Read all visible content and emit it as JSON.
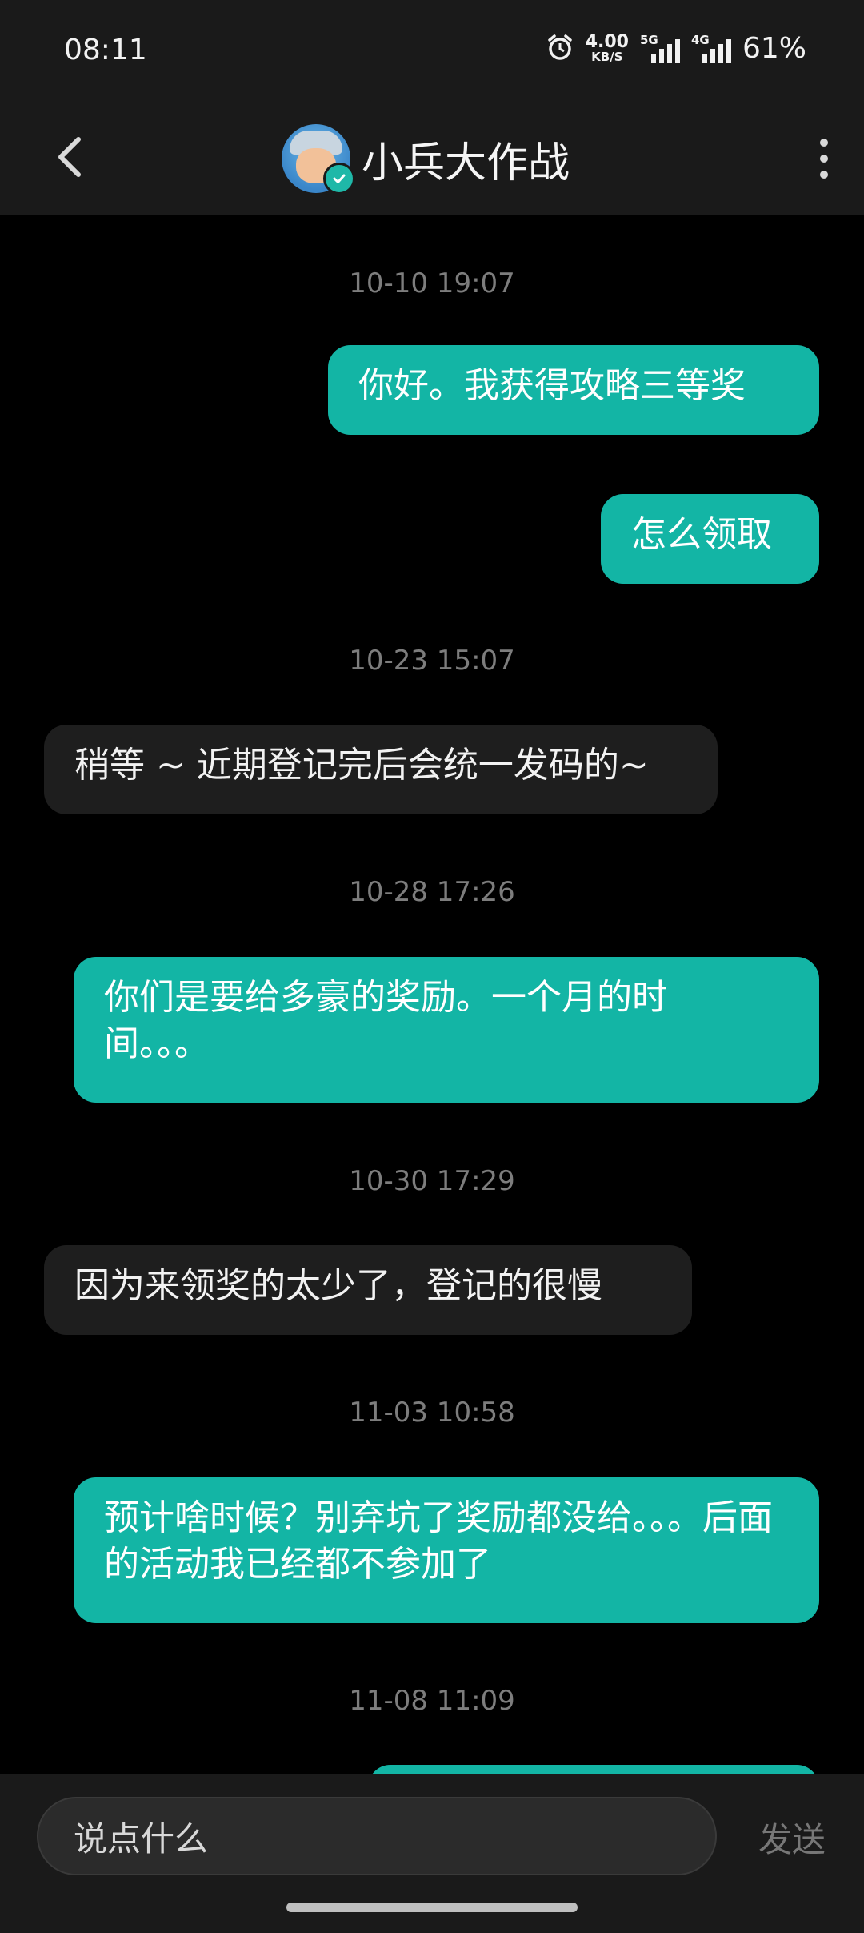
{
  "status_bar": {
    "time": "08:11",
    "net_speed_value": "4.00",
    "net_speed_unit": "KB/S",
    "sim1_tag": "5G",
    "sim2_tag": "4G",
    "battery": "61%"
  },
  "header": {
    "title": "小兵大作战",
    "accent_color": "#13b5a5"
  },
  "messages": [
    {
      "type": "timestamp",
      "text": "10-10 19:07"
    },
    {
      "type": "outgoing",
      "text": "你好。我获得攻略三等奖"
    },
    {
      "type": "outgoing",
      "text": "怎么领取"
    },
    {
      "type": "timestamp",
      "text": "10-23 15:07"
    },
    {
      "type": "incoming",
      "text": "稍等 ~ 近期登记完后会统一发码的~"
    },
    {
      "type": "timestamp",
      "text": "10-28 17:26"
    },
    {
      "type": "outgoing",
      "text": "你们是要给多豪的奖励。一个月的时间。。。"
    },
    {
      "type": "timestamp",
      "text": "10-30 17:29"
    },
    {
      "type": "incoming",
      "text": "因为来领奖的太少了，登记的很慢"
    },
    {
      "type": "timestamp",
      "text": "11-03 10:58"
    },
    {
      "type": "outgoing",
      "text": "预计啥时候？别弃坑了奖励都没给。。。后面的活动我已经都不参加了"
    },
    {
      "type": "timestamp",
      "text": "11-08 11:09"
    },
    {
      "type": "outgoing",
      "text": ""
    }
  ],
  "input": {
    "placeholder": "说点什么",
    "send_label": "发送"
  }
}
